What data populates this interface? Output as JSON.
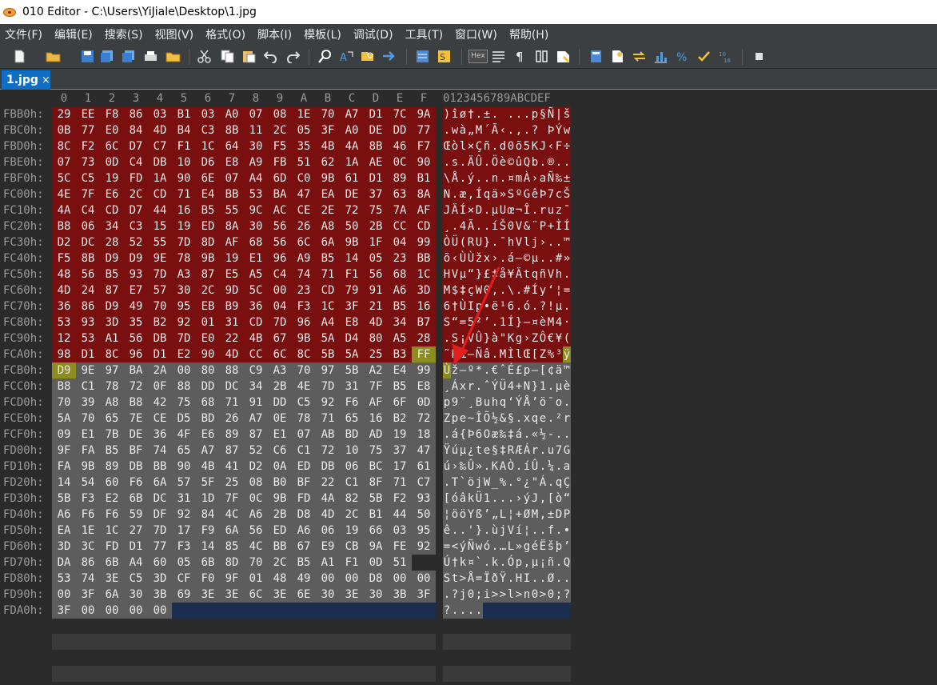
{
  "window": {
    "title": "010 Editor - C:\\Users\\YiJiale\\Desktop\\1.jpg"
  },
  "menu": [
    "文件(F)",
    "编辑(E)",
    "搜索(S)",
    "视图(V)",
    "格式(O)",
    "脚本(I)",
    "模板(L)",
    "调试(D)",
    "工具(T)",
    "窗口(W)",
    "帮助(H)"
  ],
  "toolbar": {
    "hex_label": "Hex"
  },
  "tab": {
    "label": "1.jpg",
    "close": "×"
  },
  "columns": {
    "hex": [
      "0",
      "1",
      "2",
      "3",
      "4",
      "5",
      "6",
      "7",
      "8",
      "9",
      "A",
      "B",
      "C",
      "D",
      "E",
      "F"
    ],
    "ascii": "0123456789ABCDEF"
  },
  "rows": [
    {
      "addr": "FBB0h:",
      "hex": "29 EE F8 86 03 B1 03 A0 07 08 1E 70 A7 D1 7C 9A",
      "ascii": ")îø†.±. ...p§Ñ|š",
      "style": "red"
    },
    {
      "addr": "FBC0h:",
      "hex": "0B 77 E0 84 4D B4 C3 8B 11 2C 05 3F A0 DE DD 77",
      "ascii": ".wà„M´Ã‹.,.? ÞÝw",
      "style": "red"
    },
    {
      "addr": "FBD0h:",
      "hex": "8C F2 6C D7 C7 F1 1C 64 30 F5 35 4B 4A 8B 46 F7",
      "ascii": "Œòl×Çñ.d0õ5KJ‹F÷",
      "style": "red"
    },
    {
      "addr": "FBE0h:",
      "hex": "07 73 0D C4 DB 10 D6 E8 A9 FB 51 62 1A AE 0C 90",
      "ascii": ".s.ÄÛ.Öè©ûQb.®..",
      "style": "red"
    },
    {
      "addr": "FBF0h:",
      "hex": "5C C5 19 FD 1A 90 6E 07 A4 6D C0 9B 61 D1 89 B1",
      "ascii": "\\Å.ý..n.¤mÀ›aÑ‰±",
      "style": "red"
    },
    {
      "addr": "FC00h:",
      "hex": "4E 7F E6 2C CD 71 E4 BB 53 BA 47 EA DE 37 63 8A",
      "ascii": "N.æ,Íqä»SºGêÞ7cŠ",
      "style": "red"
    },
    {
      "addr": "FC10h:",
      "hex": "4A C4 CD D7 44 16 B5 55 9C AC CE 2E 72 75 7A AF",
      "ascii": "JÄÍ×D.µUœ¬Î.ruz¯",
      "style": "red"
    },
    {
      "addr": "FC20h:",
      "hex": "B8 06 34 C3 15 19 ED 8A 30 56 26 A8 50 2B CC CD",
      "ascii": "¸.4Ã..íŠ0V&¨P+ÌÍ",
      "style": "red"
    },
    {
      "addr": "FC30h:",
      "hex": "D2 DC 28 52 55 7D 8D AF 68 56 6C 6A 9B 1F 04 99",
      "ascii": "ÒÜ(RU}.¯hVlj›..™",
      "style": "red"
    },
    {
      "addr": "FC40h:",
      "hex": "F5 8B D9 D9 9E 78 9B 19 E1 96 A9 B5 14 05 23 BB",
      "ascii": "õ‹ÙÙžx›.á–©µ..#»",
      "style": "red"
    },
    {
      "addr": "FC50h:",
      "hex": "48 56 B5 93 7D A3 87 E5 A5 C4 74 71 F1 56 68 1C",
      "ascii": "HVµ“}£‡å¥ÄtqñVh.",
      "style": "red"
    },
    {
      "addr": "FC60h:",
      "hex": "4D 24 87 E7 57 30 2C 9D 5C 00 23 CD 79 91 A6 3D",
      "ascii": "M$‡çW0,.\\.#Íy‘¦=",
      "style": "red"
    },
    {
      "addr": "FC70h:",
      "hex": "36 86 D9 49 70 95 EB B9 36 04 F3 1C 3F 21 B5 16",
      "ascii": "6†ÙIp•ë¹6.ó.?!µ.",
      "style": "red"
    },
    {
      "addr": "FC80h:",
      "hex": "53 93 3D 35 B2 92 01 31 CD 7D 96 A4 E8 4D 34 B7",
      "ascii": "S“=5²’.1Í}–¤èM4·",
      "style": "red"
    },
    {
      "addr": "FC90h:",
      "hex": "12 53 A1 56 DB 7D E0 22 4B 67 9B 5A D4 80 A5 28",
      "ascii": ".S¡VÛ}à\"Kg›ZÔ€¥(",
      "style": "red"
    },
    {
      "addr": "FCA0h:",
      "hex": "98 D1 8C 96 D1 E2 90 4D CC 6C 8C 5B 5A 25 B3 FF",
      "ascii": "˜ÑŒ–Ñâ.MÌlŒ[Z%³ÿ",
      "style": "red-end"
    },
    {
      "addr": "FCB0h:",
      "hex": "D9 9E 97 BA 2A 00 80 88 C9 A3 70 97 5B A2 E4 99",
      "ascii": "Ùž—º*.€ˆÉ£p—[¢ä™",
      "style": "grey-start"
    },
    {
      "addr": "FCC0h:",
      "hex": "B8 C1 78 72 0F 88 DD DC 34 2B 4E 7D 31 7F B5 E8",
      "ascii": "¸Áxr.ˆÝÜ4+N}1.µè",
      "style": "grey"
    },
    {
      "addr": "FCD0h:",
      "hex": "70 39 A8 B8 42 75 68 71 91 DD C5 92 F6 AF 6F 0D",
      "ascii": "p9¨¸Buhq‘ÝÅ’ö¯o.",
      "style": "grey"
    },
    {
      "addr": "FCE0h:",
      "hex": "5A 70 65 7E CE D5 BD 26 A7 0E 78 71 65 16 B2 72",
      "ascii": "Zpe~ÎÕ½&§.xqe.²r",
      "style": "grey"
    },
    {
      "addr": "FCF0h:",
      "hex": "09 E1 7B DE 36 4F E6 89 87 E1 07 AB BD AD 19 18",
      "ascii": ".á{Þ6Oæ‰‡á.«½-..",
      "style": "grey"
    },
    {
      "addr": "FD00h:",
      "hex": "9F FA B5 BF 74 65 A7 87 52 C6 C1 72 10 75 37 47",
      "ascii": "Ÿúµ¿te§‡RÆÁr.u7G",
      "style": "grey"
    },
    {
      "addr": "FD10h:",
      "hex": "FA 9B 89 DB BB 90 4B 41 D2 0A ED DB 06 BC 17 61",
      "ascii": "ú›‰Û».KAÒ.íÛ.¼.a",
      "style": "grey"
    },
    {
      "addr": "FD20h:",
      "hex": "14 54 60 F6 6A 57 5F 25 08 B0 BF 22 C1 8F 71 C7",
      "ascii": ".T`öjW_%.°¿\"Á.qÇ",
      "style": "grey"
    },
    {
      "addr": "FD30h:",
      "hex": "5B F3 E2 6B DC 31 1D 7F 0C 9B FD 4A 82 5B F2 93",
      "ascii": "[óâkÜ1...›ýJ‚[ò“",
      "style": "grey"
    },
    {
      "addr": "FD40h:",
      "hex": "A6 F6 F6 59 DF 92 84 4C A6 2B D8 4D 2C B1 44 50",
      "ascii": "¦ööYß’„L¦+ØM,±DP",
      "style": "grey"
    },
    {
      "addr": "FD50h:",
      "hex": "EA 1E 1C 27 7D 17 F9 6A 56 ED A6 06 19 66 03 95",
      "ascii": "ê..'}.ùjVí¦..f.•",
      "style": "grey"
    },
    {
      "addr": "FD60h:",
      "hex": "3D 3C FD D1 77 F3 14 85 4C BB 67 E9 CB 9A FE 92",
      "ascii": "=<ýÑwó.…L»géËšþ’",
      "style": "grey"
    },
    {
      "addr": "FD70h:",
      "hex": "DA 86 6B A4 60 05 6B 8D 70 2C B5 A1 F1 0D 51",
      "ascii": "Ú†k¤`.k.Óp,µ¡ñ.Q",
      "style": "grey"
    },
    {
      "addr": "FD80h:",
      "hex": "53 74 3E C5 3D CF F0 9F 01 48 49 00 00 D8 00 00",
      "ascii": "St>Å=ÏðŸ.HI..Ø..",
      "style": "grey"
    },
    {
      "addr": "FD90h:",
      "hex": "00 3F 6A 30 3B 69 3E 3E 6C 3E 6E 30 3E 30 3B 3F",
      "ascii": ".?j0;i>>l>n0>0;?",
      "style": "grey"
    },
    {
      "addr": "FDA0h:",
      "hex": "3F 00 00 00 00",
      "ascii": "?....",
      "style": "grey-partial"
    }
  ],
  "colors": {
    "red_region": "#7a0f0f",
    "grey_region": "#5d5d5d",
    "highlight": "#8c8c20",
    "selection_tail": "#1b2d50",
    "annotation_arrow": "#e02020"
  }
}
